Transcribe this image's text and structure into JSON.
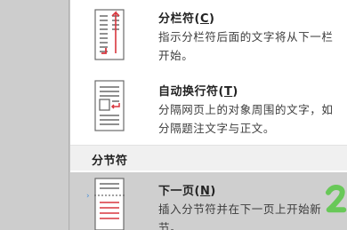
{
  "menu": {
    "column_break": {
      "title": "分栏符(C)",
      "title_main": "分栏符(",
      "title_key": "C",
      "title_end": ")",
      "desc": "指示分栏符后面的文字将从下一栏开始。",
      "icon": "column-break-icon"
    },
    "text_wrapping": {
      "title": "自动换行符(T)",
      "title_main": "自动换行符(",
      "title_key": "T",
      "title_end": ")",
      "desc": "分隔网页上的对象周围的文字，如分隔题注文字与正文。",
      "icon": "text-wrapping-break-icon"
    },
    "section_header": "分节符",
    "next_page": {
      "title": "下一页(N)",
      "title_main": "下一页(",
      "title_key": "N",
      "title_end": ")",
      "desc": "插入分节符并在下一页上开始新节。",
      "icon": "next-page-break-icon"
    }
  },
  "colors": {
    "accent_red": "#d9363e",
    "highlight": "#cfcfcf",
    "scribble_green": "#5cc74a"
  }
}
